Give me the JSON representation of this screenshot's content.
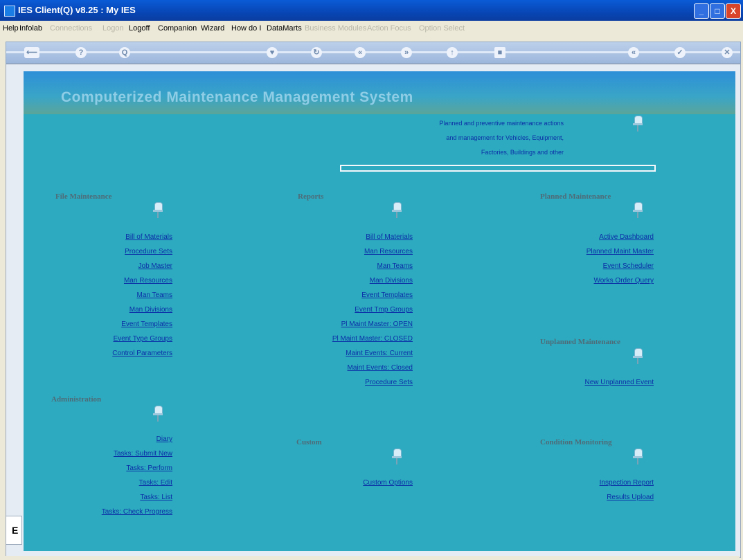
{
  "window": {
    "title": "IES Client(Q) v8.25 : My IES",
    "min": "_",
    "max": "□",
    "close": "X"
  },
  "menu": [
    {
      "label": "Help",
      "dim": false
    },
    {
      "label": "Infolab",
      "dim": false
    },
    {
      "label": "Connections",
      "dim": true
    },
    {
      "label": "Logon",
      "dim": true
    },
    {
      "label": "Logoff",
      "dim": false
    },
    {
      "label": "Companion",
      "dim": false
    },
    {
      "label": "Wizard",
      "dim": false
    },
    {
      "label": "How do I",
      "dim": false
    },
    {
      "label": "DataMarts",
      "dim": false
    },
    {
      "label": "Business Modules",
      "dim": true
    },
    {
      "label": "Action Focus",
      "dim": true
    },
    {
      "label": "Option Select",
      "dim": true
    }
  ],
  "toolbar": {
    "icons": [
      "exit-icon",
      "help-icon",
      "search-icon",
      "heart-icon",
      "refresh-icon",
      "back-icon",
      "forward-icon",
      "up-icon",
      "stop-icon",
      "collapse-icon",
      "check-icon",
      "close-icon"
    ],
    "glyphs": [
      "⟵",
      "?",
      "Q",
      "♥",
      "↻",
      "«",
      "»",
      "↑",
      "■",
      "«",
      "✓",
      "✕"
    ]
  },
  "banner": {
    "title": "Computerized Maintenance Management System"
  },
  "description": {
    "line1": "Planned and preventive maintenance actions",
    "line2": "and management for Vehicles, Equipment,",
    "line3": "Factories, Buildings and other"
  },
  "sections": {
    "file_maintenance": {
      "title": "File Maintenance",
      "links": [
        "Bill of Materials",
        "Procedure Sets",
        "Job Master",
        "Man Resources",
        "Man Teams",
        "Man Divisions",
        "Event Templates",
        "Event Type Groups",
        "Control Parameters"
      ]
    },
    "reports": {
      "title": "Reports",
      "links": [
        "Bill of Materials",
        "Man Resources",
        "Man Teams",
        "Man Divisions",
        "Event Templates",
        "Event Tmp Groups",
        "Pl Maint Master: OPEN",
        "Pl Maint Master: CLOSED",
        "Maint Events: Current",
        "Maint Events: Closed",
        "Procedure Sets"
      ]
    },
    "planned_maintenance": {
      "title": "Planned Maintenance",
      "links": [
        "Active Dashboard",
        "Planned Maint Master",
        "Event Scheduler",
        "Works Order Query"
      ]
    },
    "unplanned_maintenance": {
      "title": "Unplanned Maintenance",
      "links": [
        "New Unplanned Event"
      ]
    },
    "administration": {
      "title": "Administration",
      "links": [
        "Diary",
        "Tasks: Submit New",
        "Tasks: Perform",
        "Tasks: Edit",
        "Tasks: List",
        "Tasks: Check Progress"
      ]
    },
    "custom": {
      "title": "Custom",
      "links": [
        "Custom Options"
      ]
    },
    "condition_monitoring": {
      "title": "Condition Monitoring",
      "links": [
        "Inspection Report",
        "Results Upload"
      ]
    }
  },
  "side_tab": {
    "label": "E"
  }
}
